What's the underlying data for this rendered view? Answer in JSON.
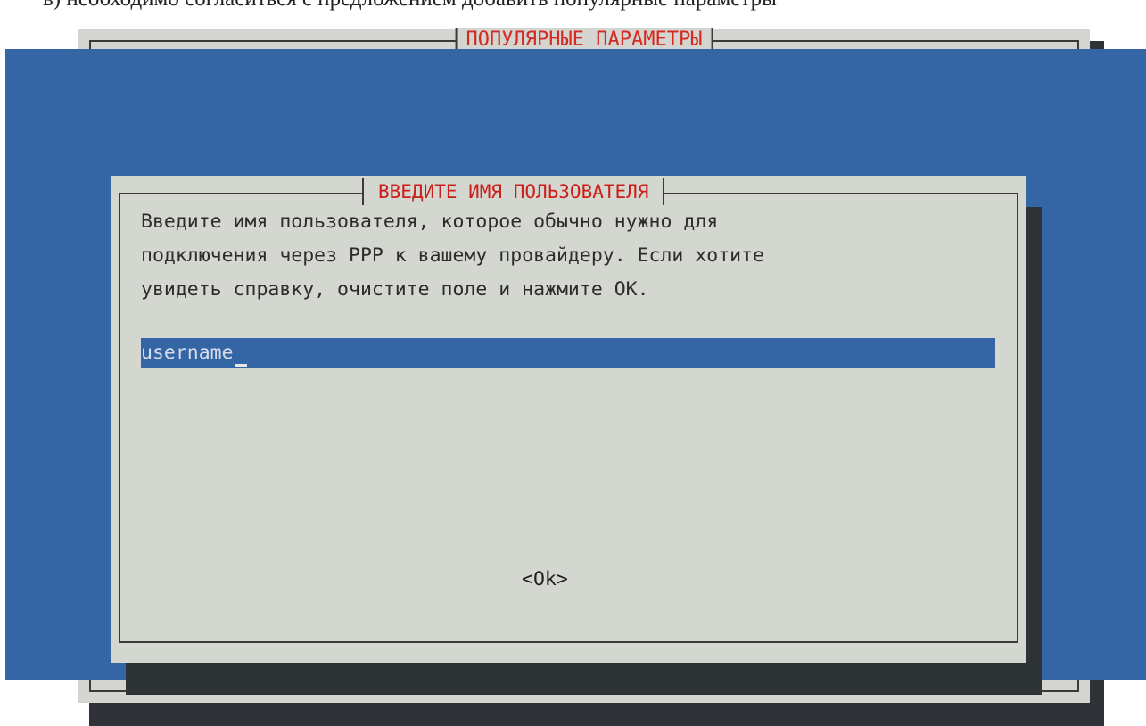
{
  "caption": "в) необходимо согласиться с предложением добавить популярные параметры",
  "background_dialog": {
    "title": "ПОПУЛЯРНЫЕ ПАРАМЕТРЫ"
  },
  "dialog": {
    "title": "ВВЕДИТЕ ИМЯ ПОЛЬЗОВАТЕЛЯ",
    "message_lines": [
      "Введите имя пользователя, которое обычно нужно для",
      "подключения через PPP к вашему провайдеру. Если хотите",
      "увидеть справку, очистите поле и нажмите OK."
    ],
    "input_value": "username",
    "ok_label": "<Ok>"
  },
  "colors": {
    "screen_blue": "#3465a4",
    "dialog_gray": "#d3d7cf",
    "title_red": "#cc1f1a",
    "shadow": "#2e3336"
  }
}
